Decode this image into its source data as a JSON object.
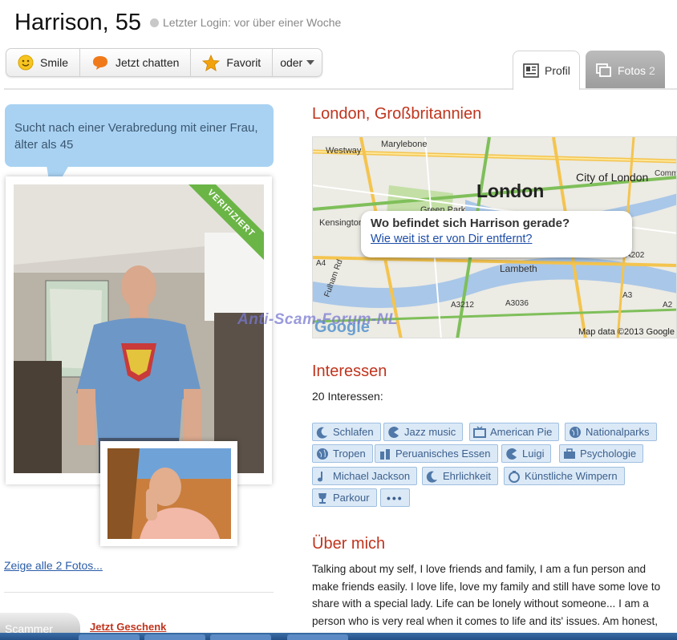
{
  "header": {
    "name": "Harrison, 55",
    "last_login": "Letzter Login: vor über einer Woche"
  },
  "actions": {
    "smile": "Smile",
    "chat": "Jetzt chatten",
    "favorite": "Favorit",
    "more": "oder"
  },
  "tabs": {
    "profile": "Profil",
    "photos": "Fotos",
    "photos_count": "2"
  },
  "sidebar": {
    "seeking": "Sucht nach einer Verabredung mit einer Frau, älter als 45",
    "verified_badge": "VERIFIZIERT",
    "show_all_photos": "Zeige alle 2 Fotos...",
    "gift_link": "Jetzt Geschenk",
    "gift_image_text": "Scammer profile"
  },
  "location": {
    "title": "London, Großbritannien",
    "map_labels": [
      "Westway",
      "Marylebone",
      "London",
      "City of London",
      "Green Park",
      "Kensington Gardens",
      "Lambeth",
      "A4",
      "A3212",
      "A3",
      "A2",
      "A202",
      "A3036",
      "Fulham Rd",
      "Comm"
    ],
    "popup_question": "Wo befindet sich Harrison gerade?",
    "popup_link": "Wie weit ist er von Dir entfernt?",
    "attribution": "Map data ©2013 Google",
    "logo": "Google"
  },
  "watermark": "Anti-Scam-Forum-NL",
  "interests": {
    "title": "Interessen",
    "count_label": "20 Interessen:",
    "items": [
      {
        "label": "Schlafen",
        "icon": "moon-icon"
      },
      {
        "label": "Jazz music",
        "icon": "pacman-icon"
      },
      {
        "label": "American Pie",
        "icon": "tv-icon"
      },
      {
        "label": "Nationalparks",
        "icon": "globe-icon"
      },
      {
        "label": "Tropen",
        "icon": "globe-icon"
      },
      {
        "label": "Peruanisches Essen",
        "icon": "food-icon"
      },
      {
        "label": "Luigi",
        "icon": "pacman-icon"
      },
      {
        "label": "Psychologie",
        "icon": "briefcase-icon"
      },
      {
        "label": "Michael Jackson",
        "icon": "music-note-icon"
      },
      {
        "label": "Ehrlichkeit",
        "icon": "moon-icon"
      },
      {
        "label": "Künstliche Wimpern",
        "icon": "stopwatch-icon"
      },
      {
        "label": "Parkour",
        "icon": "trophy-icon"
      }
    ],
    "more": "•••"
  },
  "about": {
    "title": "Über mich",
    "text": "Talking about my self, I love friends and family, I am a fun person and make friends easily. I love life, love my family and still have some love to share with a special lady. Life can be lonely without someone... I am a person who is very real when it comes to life and its' issues. Am honest,"
  },
  "colors": {
    "accent_red": "#c0341d",
    "bubble_blue": "#a9d2f2",
    "tag_bg": "#dbe9f7",
    "link_blue": "#2a5ca8",
    "verified_green": "#6bb547"
  }
}
